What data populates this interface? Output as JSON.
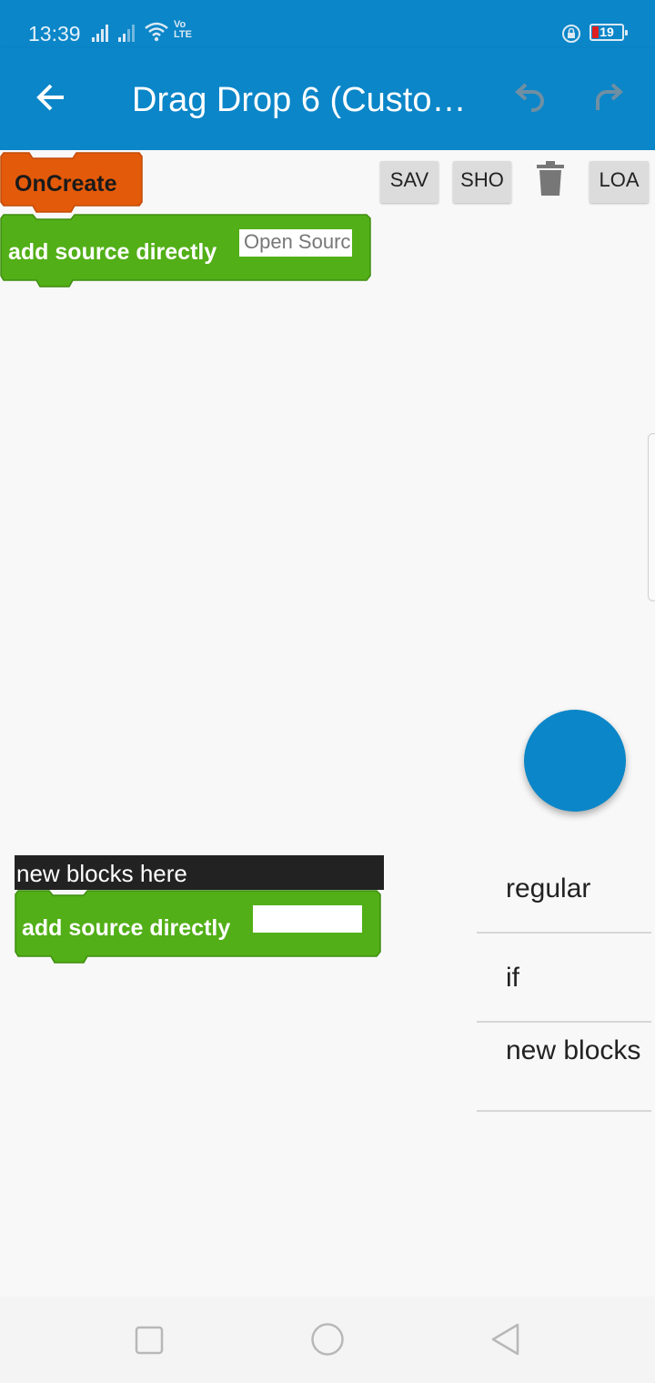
{
  "status_bar": {
    "time": "13:39",
    "network_label": "Vo LTE",
    "battery_level": "19"
  },
  "app_bar": {
    "title": "Drag Drop 6 (Custo…",
    "icons": [
      "back-arrow-icon",
      "undo-icon",
      "redo-icon"
    ]
  },
  "toolbar": {
    "save_label": "SAV",
    "show_label": "SHO",
    "load_label": "LOA"
  },
  "workspace_blocks": {
    "oncreate_label": "OnCreate",
    "add_source_label": "add source directly",
    "add_source_value": "Open Sourc",
    "colors": {
      "event_block": "#e35a0a",
      "source_block": "#52af17",
      "app_bar": "#0b86c8"
    }
  },
  "palette": {
    "header": "new blocks here",
    "block_label": "add source directly",
    "block_value": ""
  },
  "categories": [
    {
      "label": "regular"
    },
    {
      "label": "if"
    },
    {
      "label": "new blocks"
    }
  ]
}
